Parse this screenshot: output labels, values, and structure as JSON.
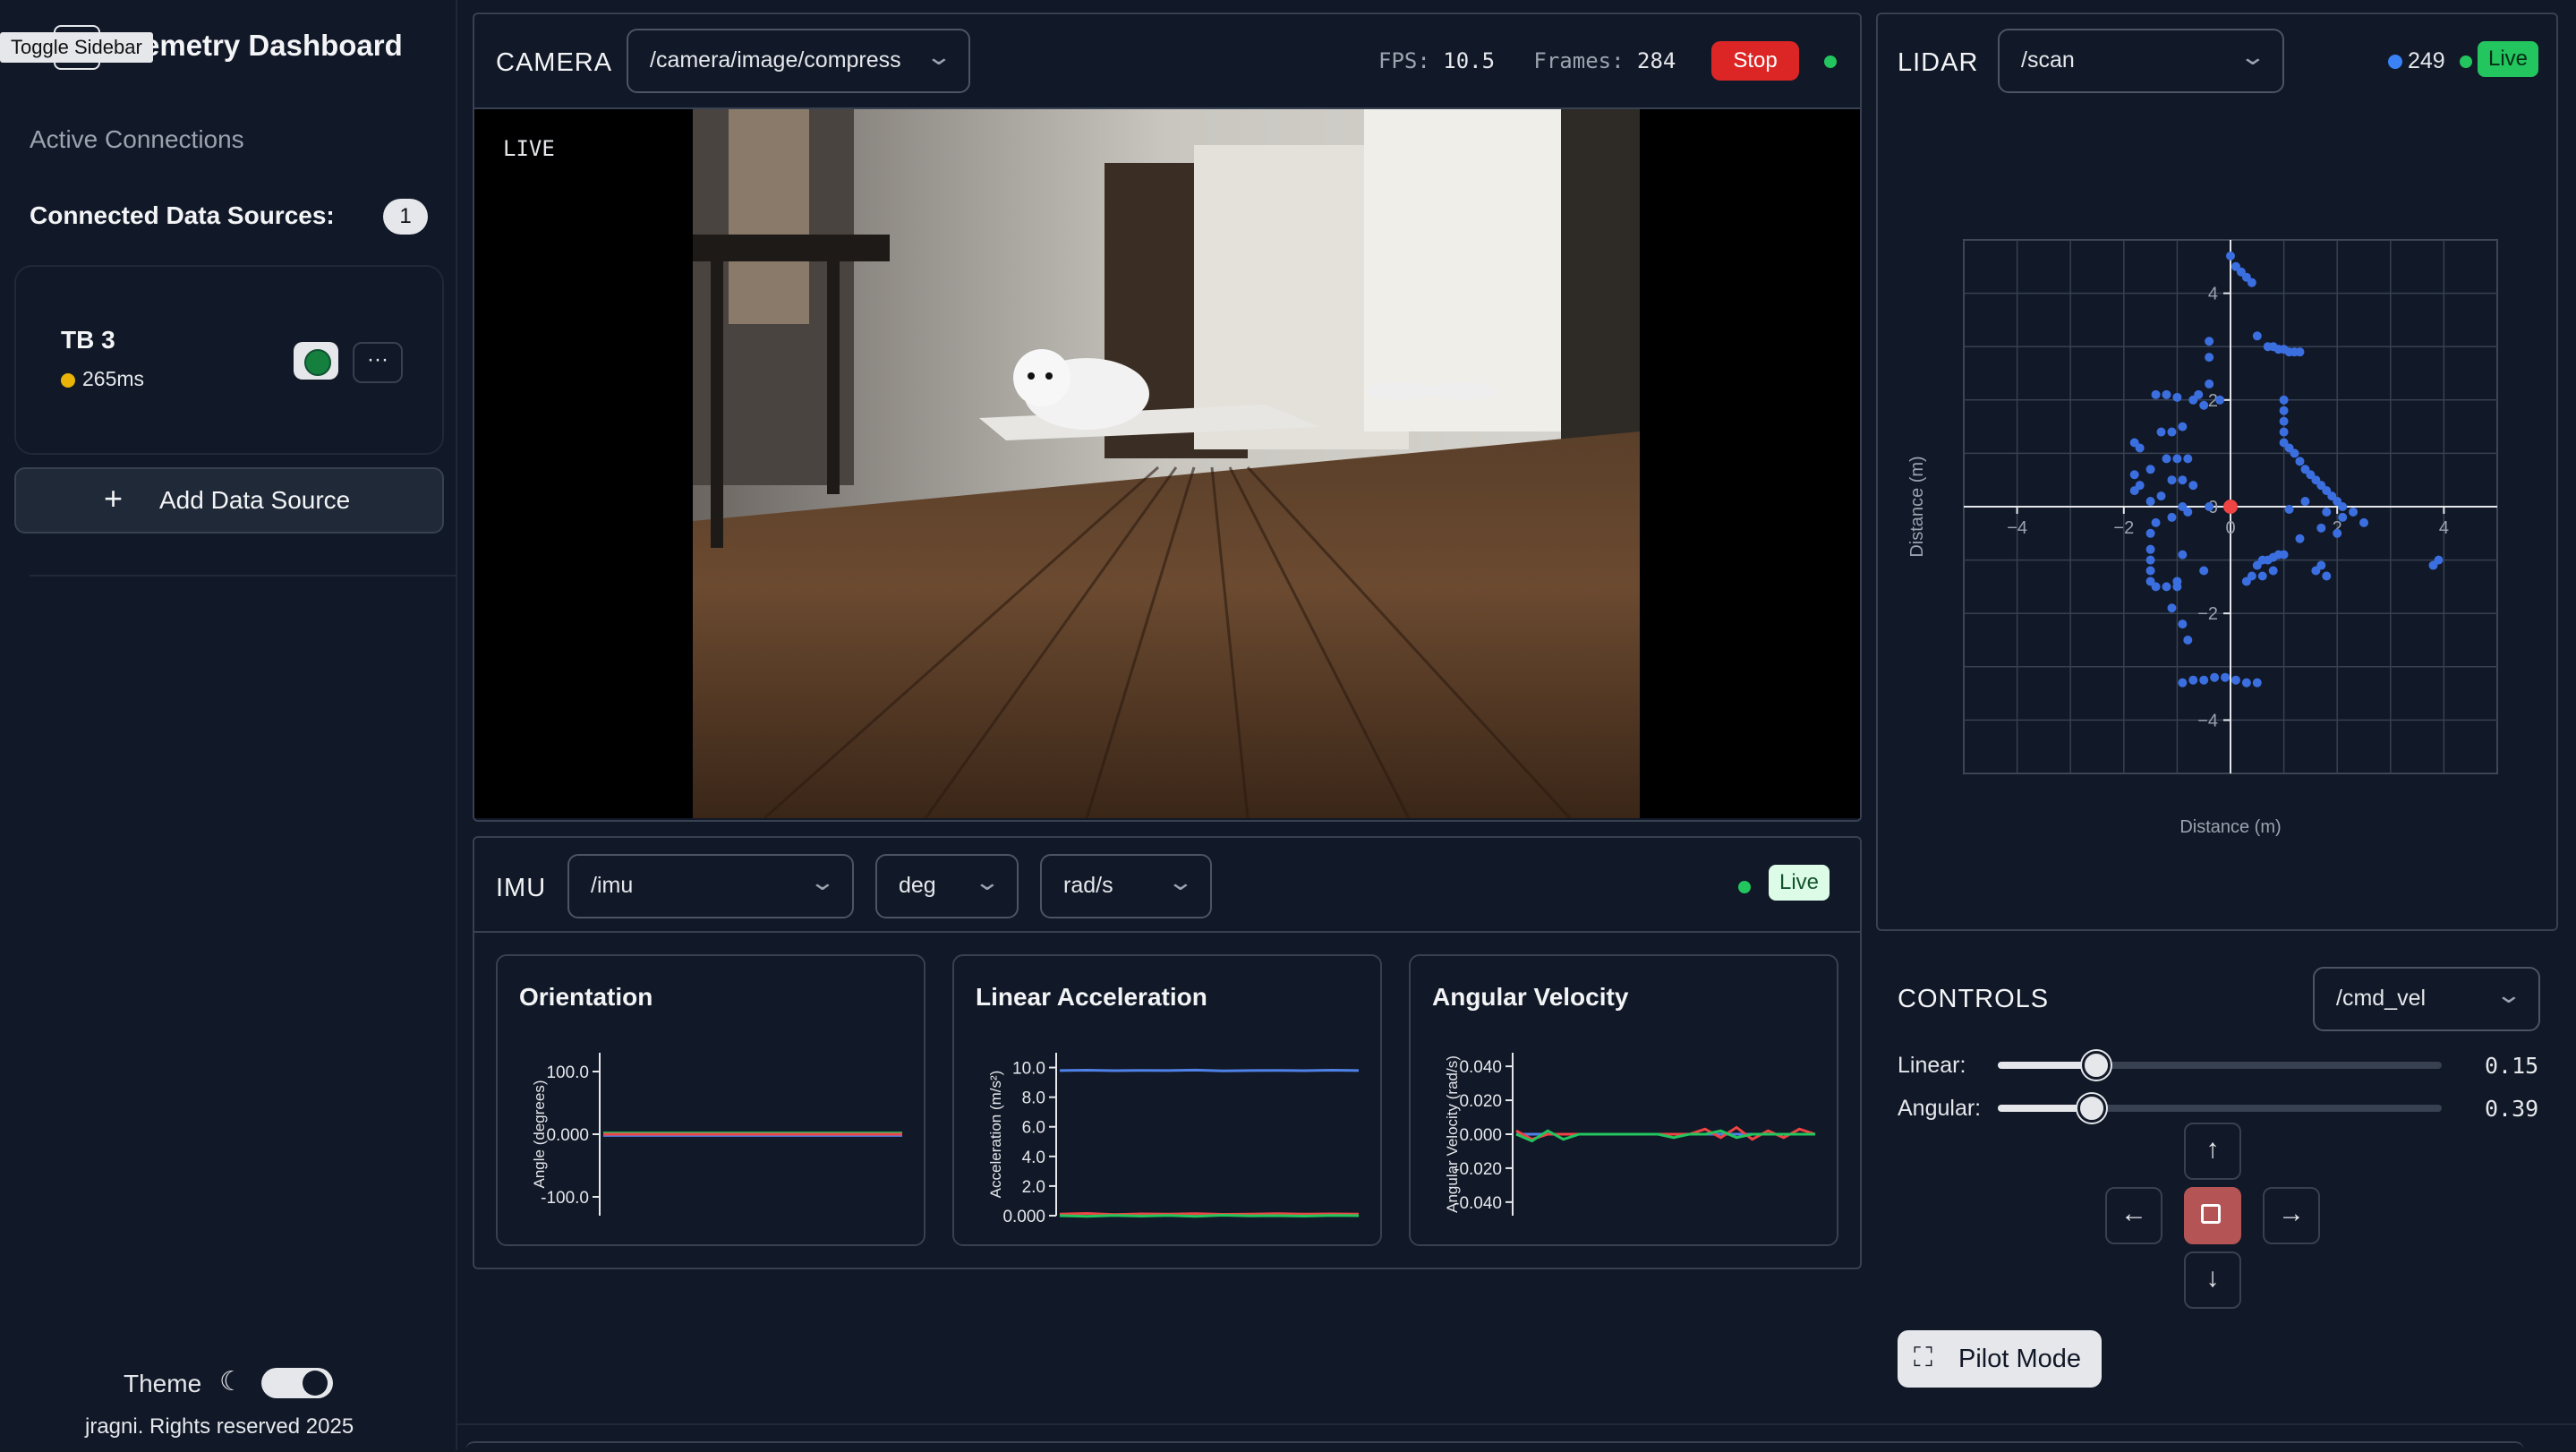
{
  "sidebar": {
    "tooltip": "Toggle Sidebar",
    "app_title": "emetry Dashboard",
    "active_connections": "Active Connections",
    "connected_label": "Connected Data Sources:",
    "connected_count": "1",
    "source": {
      "name": "TB 3",
      "latency": "265ms",
      "more": "···",
      "status_color": "#15803d",
      "latency_dot_color": "#eab308"
    },
    "add_source": "Add Data Source",
    "theme_label": "Theme",
    "copyright": "jragni. Rights reserved 2025"
  },
  "camera": {
    "title": "CAMERA",
    "topic": "/camera/image/compress",
    "fps_label": "FPS:",
    "fps_value": "10.5",
    "frames_label": "Frames:",
    "frames_value": "284",
    "stop_label": "Stop",
    "live_tag": "LIVE"
  },
  "lidar": {
    "title": "LIDAR",
    "topic": "/scan",
    "point_count": "249",
    "live_label": "Live",
    "chart_data": {
      "type": "scatter",
      "xlabel": "Distance (m)",
      "ylabel": "Distance (m)",
      "xlim": [
        -5,
        5
      ],
      "ylim": [
        -5,
        5
      ],
      "x_ticks": [
        "−4",
        "−2",
        "0",
        "2",
        "4"
      ],
      "y_ticks": [
        "4",
        "2",
        "0",
        "−2",
        "−4"
      ],
      "grid": true,
      "point_color": "#3b6fe0",
      "origin_color": "#ef4444",
      "points": [
        [
          0.0,
          4.7
        ],
        [
          0.1,
          4.5
        ],
        [
          0.2,
          4.4
        ],
        [
          0.3,
          4.3
        ],
        [
          0.4,
          4.2
        ],
        [
          0.5,
          3.2
        ],
        [
          0.7,
          3.0
        ],
        [
          0.8,
          3.0
        ],
        [
          0.9,
          2.95
        ],
        [
          1.0,
          2.95
        ],
        [
          1.1,
          2.9
        ],
        [
          1.2,
          2.9
        ],
        [
          1.3,
          2.9
        ],
        [
          -0.4,
          3.1
        ],
        [
          -0.4,
          2.8
        ],
        [
          -0.4,
          2.3
        ],
        [
          -0.2,
          2.0
        ],
        [
          -1.4,
          2.1
        ],
        [
          -1.2,
          2.1
        ],
        [
          -1.0,
          2.05
        ],
        [
          -0.7,
          2.0
        ],
        [
          -0.6,
          2.1
        ],
        [
          -0.5,
          1.9
        ],
        [
          -1.8,
          1.2
        ],
        [
          -1.7,
          1.1
        ],
        [
          -1.3,
          1.4
        ],
        [
          -1.1,
          1.4
        ],
        [
          -0.9,
          1.5
        ],
        [
          -1.2,
          0.9
        ],
        [
          -1.0,
          0.9
        ],
        [
          -0.8,
          0.9
        ],
        [
          -1.5,
          0.7
        ],
        [
          -1.8,
          0.6
        ],
        [
          -1.7,
          0.4
        ],
        [
          -1.8,
          0.3
        ],
        [
          -1.1,
          0.5
        ],
        [
          -0.9,
          0.5
        ],
        [
          -0.7,
          0.4
        ],
        [
          -1.3,
          0.2
        ],
        [
          -1.5,
          0.1
        ],
        [
          -0.9,
          0.0
        ],
        [
          -0.8,
          -0.1
        ],
        [
          -1.1,
          -0.2
        ],
        [
          -1.4,
          -0.3
        ],
        [
          -0.4,
          0.0
        ],
        [
          1.0,
          2.0
        ],
        [
          1.0,
          1.8
        ],
        [
          1.0,
          1.6
        ],
        [
          1.0,
          1.4
        ],
        [
          1.0,
          1.2
        ],
        [
          1.1,
          1.1
        ],
        [
          1.2,
          1.0
        ],
        [
          1.3,
          0.85
        ],
        [
          1.4,
          0.7
        ],
        [
          1.5,
          0.6
        ],
        [
          1.6,
          0.5
        ],
        [
          1.7,
          0.4
        ],
        [
          1.8,
          0.3
        ],
        [
          1.9,
          0.2
        ],
        [
          2.0,
          0.1
        ],
        [
          2.1,
          0.0
        ],
        [
          2.1,
          -0.2
        ],
        [
          2.5,
          -0.3
        ],
        [
          2.3,
          -0.1
        ],
        [
          1.7,
          -0.4
        ],
        [
          2.0,
          -0.5
        ],
        [
          1.1,
          -0.05
        ],
        [
          1.4,
          0.1
        ],
        [
          1.8,
          -0.1
        ],
        [
          1.3,
          -0.6
        ],
        [
          3.8,
          -1.1
        ],
        [
          3.9,
          -1.0
        ],
        [
          1.6,
          -1.2
        ],
        [
          1.8,
          -1.3
        ],
        [
          1.7,
          -1.1
        ],
        [
          0.5,
          -1.1
        ],
        [
          0.6,
          -1.0
        ],
        [
          0.8,
          -0.95
        ],
        [
          0.9,
          -0.9
        ],
        [
          1.0,
          -0.9
        ],
        [
          0.7,
          -1.0
        ],
        [
          0.4,
          -1.3
        ],
        [
          0.3,
          -1.4
        ],
        [
          0.6,
          -1.3
        ],
        [
          0.8,
          -1.2
        ],
        [
          -1.5,
          -0.5
        ],
        [
          -1.5,
          -0.8
        ],
        [
          -1.5,
          -1.0
        ],
        [
          -1.5,
          -1.2
        ],
        [
          -1.5,
          -1.4
        ],
        [
          -1.4,
          -1.5
        ],
        [
          -1.2,
          -1.5
        ],
        [
          -1.0,
          -1.5
        ],
        [
          -1.0,
          -1.4
        ],
        [
          -1.1,
          -1.9
        ],
        [
          -0.9,
          -2.2
        ],
        [
          -0.8,
          -2.5
        ],
        [
          -0.5,
          -1.2
        ],
        [
          -0.9,
          -0.9
        ],
        [
          -0.9,
          -3.3
        ],
        [
          -0.7,
          -3.25
        ],
        [
          -0.5,
          -3.25
        ],
        [
          -0.3,
          -3.2
        ],
        [
          -0.1,
          -3.2
        ],
        [
          0.1,
          -3.25
        ],
        [
          0.3,
          -3.3
        ],
        [
          0.5,
          -3.3
        ]
      ]
    }
  },
  "imu": {
    "title": "IMU",
    "topic": "/imu",
    "angle_unit": "deg",
    "rate_unit": "rad/s",
    "live_label": "Live",
    "charts": [
      {
        "title": "Orientation",
        "chart_data": {
          "type": "line",
          "ylabel": "Angle (degrees)",
          "y_ticks": [
            "100.0",
            "0.000",
            "-100.0"
          ],
          "ylim": [
            -130,
            130
          ],
          "series": [
            {
              "color": "#4f82e8",
              "values": [
                -2,
                -2,
                -2,
                -2,
                -2,
                -2,
                -2,
                -2,
                -2,
                -2
              ]
            },
            {
              "color": "#22c55e",
              "values": [
                2,
                2,
                2,
                2,
                2,
                2,
                2,
                2,
                2,
                2
              ]
            },
            {
              "color": "#ef4444",
              "values": [
                0,
                0,
                0,
                0,
                0,
                0,
                0,
                0,
                0,
                0
              ]
            }
          ]
        }
      },
      {
        "title": "Linear Acceleration",
        "chart_data": {
          "type": "line",
          "ylabel": "Acceleration (m/s²)",
          "y_ticks": [
            "10.0",
            "8.0",
            "6.0",
            "4.0",
            "2.0",
            "0.000"
          ],
          "ylim": [
            0,
            11
          ],
          "series": [
            {
              "color": "#4f82e8",
              "values": [
                9.8,
                9.82,
                9.79,
                9.81,
                9.8,
                9.83,
                9.78,
                9.8,
                9.81,
                9.79,
                9.82,
                9.8
              ]
            },
            {
              "color": "#ef4444",
              "values": [
                0.1,
                0.15,
                0.08,
                0.12,
                0.1,
                0.14,
                0.09,
                0.11,
                0.13,
                0.1,
                0.12,
                0.1
              ]
            },
            {
              "color": "#22c55e",
              "values": [
                0.0,
                -0.05,
                0.02,
                -0.03,
                0.01,
                -0.04,
                0.03,
                -0.02,
                0.0,
                -0.03,
                0.02,
                0.0
              ]
            }
          ]
        }
      },
      {
        "title": "Angular Velocity",
        "chart_data": {
          "type": "line",
          "ylabel": "Angular Velocity (rad/s)",
          "y_ticks": [
            "0.040",
            "0.020",
            "0.000",
            "-0.020",
            "-0.040"
          ],
          "ylim": [
            -0.048,
            0.048
          ],
          "series": [
            {
              "color": "#4f82e8",
              "values": [
                0,
                0,
                0,
                0,
                0,
                0,
                0,
                0,
                0,
                0,
                0,
                0,
                0,
                0,
                0,
                0,
                0,
                0,
                0,
                0
              ]
            },
            {
              "color": "#ef4444",
              "values": [
                0.002,
                -0.003,
                0,
                0,
                0,
                0,
                0,
                0,
                0,
                0,
                0,
                0,
                0.003,
                -0.002,
                0.004,
                -0.003,
                0.002,
                -0.002,
                0.003,
                0
              ]
            },
            {
              "color": "#22c55e",
              "values": [
                0,
                -0.004,
                0.002,
                -0.003,
                0,
                0,
                0,
                0,
                0,
                0,
                -0.002,
                0,
                0,
                0.002,
                -0.002,
                0,
                0,
                0,
                0,
                0
              ]
            }
          ]
        }
      }
    ]
  },
  "controls": {
    "title": "CONTROLS",
    "topic": "/cmd_vel",
    "linear_label": "Linear:",
    "linear_value": "0.15",
    "linear_fraction": 0.22,
    "angular_label": "Angular:",
    "angular_value": "0.39",
    "angular_fraction": 0.21,
    "pilot_label": "Pilot Mode"
  }
}
